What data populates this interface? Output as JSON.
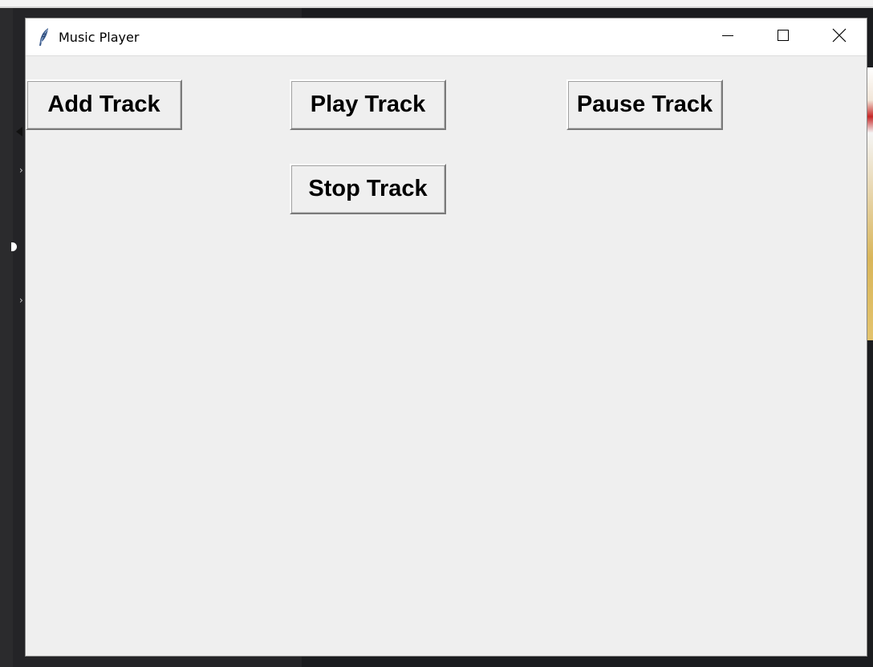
{
  "window": {
    "title": "Music Player",
    "app_icon": "feather-icon",
    "caption_buttons": {
      "minimize": "minimize-icon",
      "maximize": "maximize-icon",
      "close": "close-icon"
    }
  },
  "controls": {
    "add_label": "Add Track",
    "play_label": "Play Track",
    "pause_label": "Pause Track",
    "stop_label": "Stop Track"
  },
  "colors": {
    "window_bg": "#efefef",
    "titlebar_bg": "#ffffff"
  }
}
